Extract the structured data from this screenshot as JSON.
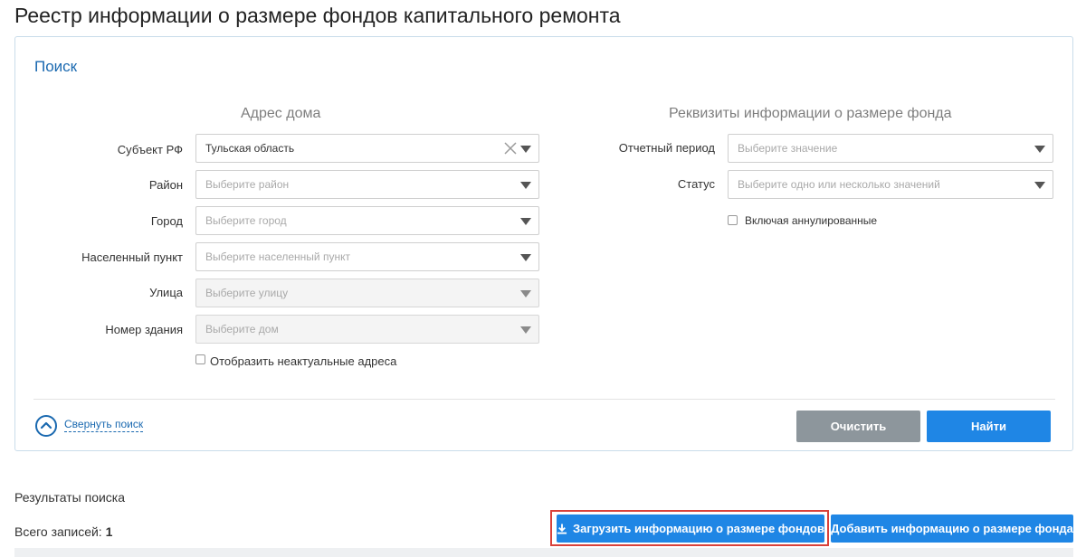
{
  "page": {
    "title": "Реестр информации о размере фондов капитального ремонта"
  },
  "search": {
    "title": "Поиск",
    "address": {
      "title": "Адрес дома",
      "fields": [
        {
          "label": "Субъект РФ",
          "value": "Тульская область",
          "placeholder": ""
        },
        {
          "label": "Район",
          "value": "",
          "placeholder": "Выберите район"
        },
        {
          "label": "Город",
          "value": "",
          "placeholder": "Выберите город"
        },
        {
          "label": "Населенный пункт",
          "value": "",
          "placeholder": "Выберите населенный пункт"
        },
        {
          "label": "Улица",
          "value": "",
          "placeholder": "Выберите улицу"
        },
        {
          "label": "Номер здания",
          "value": "",
          "placeholder": "Выберите дом"
        }
      ],
      "show_outdated_label": "Отобразить неактуальные адреса",
      "show_outdated_checked": false
    },
    "requisites": {
      "title": "Реквизиты информации о размере фонда",
      "fields": [
        {
          "label": "Отчетный период",
          "value": "",
          "placeholder": "Выберите значение"
        },
        {
          "label": "Статус",
          "value": "",
          "placeholder": "Выберите одно или несколько значений"
        }
      ],
      "include_annulled_label": "Включая аннулированные",
      "include_annulled_checked": false
    },
    "collapse_label": "Свернуть поиск",
    "clear_label": "Очистить",
    "find_label": "Найти"
  },
  "results": {
    "title": "Результаты поиска",
    "total_label": "Всего записей:",
    "total_count": "1",
    "upload_label": "Загрузить информацию о размере фондов",
    "add_label": "Добавить информацию о размере фонда"
  },
  "colors": {
    "accent": "#1f86e5",
    "link": "#1a69b0",
    "highlight": "#d9413a",
    "secondary_button": "#8d969c"
  }
}
